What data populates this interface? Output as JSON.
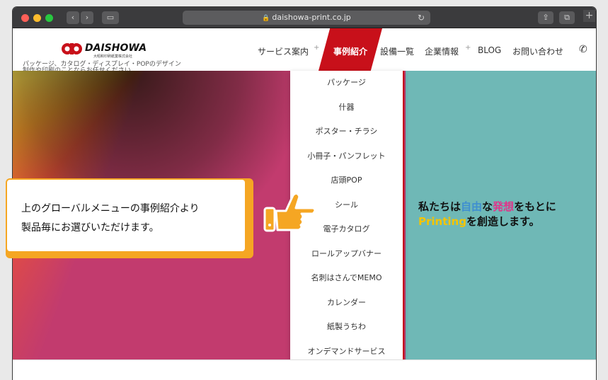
{
  "browser": {
    "url": "daishowa-print.co.jp"
  },
  "header": {
    "logo_text": "DAISHOWA",
    "logo_sub": "大昭和印刷紙業株式会社",
    "tagline": "パッケージ、カタログ・ディスプレイ・POPのデザイン制作や印刷のことならお任せください。",
    "nav": [
      {
        "label": "サービス案内"
      },
      {
        "label": "事例紹介"
      },
      {
        "label": "設備一覧"
      },
      {
        "label": "企業情報"
      },
      {
        "label": "BLOG"
      },
      {
        "label": "お問い合わせ"
      }
    ],
    "plus": "+"
  },
  "dropdown": {
    "items": [
      "パッケージ",
      "什器",
      "ポスター・チラシ",
      "小冊子・パンフレット",
      "店頭POP",
      "シール",
      "電子カタログ",
      "ロールアップバナー",
      "名刺はさんでMEMO",
      "カレンダー",
      "紙製うちわ",
      "オンデマンドサービス"
    ]
  },
  "hero": {
    "line1_a": "私たちは",
    "line1_b": "自由",
    "line1_c": "な",
    "line1_d": "発想",
    "line1_e": "をもとに",
    "line2_a": "Printing",
    "line2_b": "を創造します。"
  },
  "callout": {
    "line1": "上のグローバルメニューの事例紹介より",
    "line2": "製品毎にお選びいただけます。"
  },
  "colors": {
    "accent": "#c8101a",
    "callout": "#f5a623",
    "hero_bg": "#6fb8b6",
    "jiyu": "#3f8fd0",
    "hassou": "#e0358a",
    "printing": "#f5c400"
  }
}
